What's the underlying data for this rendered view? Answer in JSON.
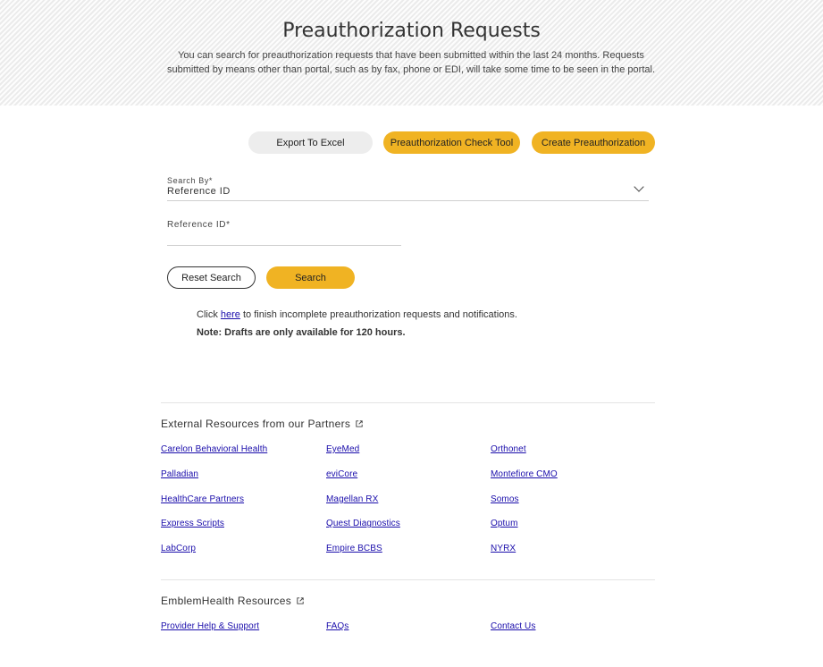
{
  "header": {
    "title": "Preauthorization Requests",
    "description": "You can search for preauthorization requests that have been submitted within the last 24 months. Requests submitted by means other than portal, such as by fax, phone or EDI, will take some time to be seen in the portal."
  },
  "actions": {
    "export_label": "Export To Excel",
    "check_tool_label": "Preauthorization Check Tool",
    "create_label": "Create Preauthorization"
  },
  "search_by": {
    "label": "Search By*",
    "value": "Reference ID"
  },
  "reference_id": {
    "label": "Reference ID*",
    "value": ""
  },
  "search_actions": {
    "reset_label": "Reset Search",
    "search_label": "Search"
  },
  "notes": {
    "click_prefix": "Click ",
    "here_link": "here",
    "click_suffix": " to finish incomplete preauthorization requests and notifications.",
    "drafts_note": "Note: Drafts are only available for 120 hours."
  },
  "external_resources": {
    "title": "External Resources from our Partners",
    "links": [
      "Carelon Behavioral Health",
      "EyeMed",
      "Orthonet",
      "Palladian",
      "eviCore",
      "Montefiore CMO",
      "HealthCare Partners",
      "Magellan RX",
      "Somos",
      "Express Scripts",
      "Quest Diagnostics",
      "Optum",
      "LabCorp",
      "Empire BCBS",
      "NYRX"
    ]
  },
  "emblem_resources": {
    "title": "EmblemHealth Resources",
    "links": [
      "Provider Help & Support",
      "FAQs",
      "Contact Us"
    ]
  },
  "colors": {
    "accent": "#f0b323",
    "link": "#1a0dab",
    "header_bg": "#f3f3f3"
  }
}
